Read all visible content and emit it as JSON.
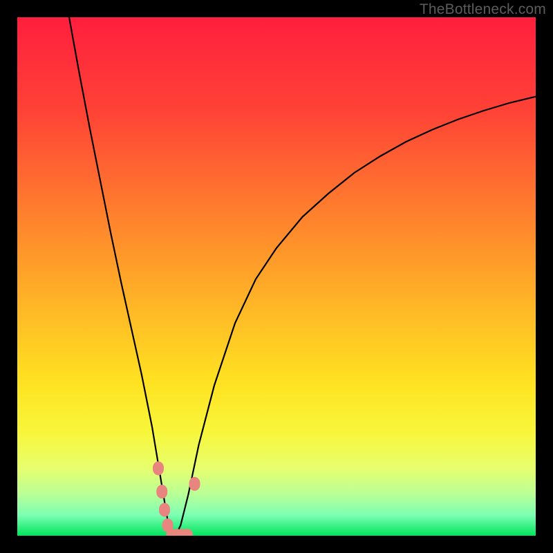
{
  "watermark": "TheBottleneck.com",
  "chart_data": {
    "type": "line",
    "title": "",
    "xlabel": "",
    "ylabel": "",
    "xlim": [
      0,
      100
    ],
    "ylim": [
      0,
      100
    ],
    "grid": false,
    "legend": false,
    "background_gradient_stops": [
      {
        "pos": 0.0,
        "color": "#ff1f3e"
      },
      {
        "pos": 0.18,
        "color": "#ff4236"
      },
      {
        "pos": 0.36,
        "color": "#ff7a2e"
      },
      {
        "pos": 0.54,
        "color": "#ffb127"
      },
      {
        "pos": 0.7,
        "color": "#ffe121"
      },
      {
        "pos": 0.8,
        "color": "#f8f63a"
      },
      {
        "pos": 0.87,
        "color": "#e7ff6e"
      },
      {
        "pos": 0.92,
        "color": "#b9ff97"
      },
      {
        "pos": 0.96,
        "color": "#7dffb3"
      },
      {
        "pos": 1.0,
        "color": "#00e45c"
      }
    ],
    "series": [
      {
        "name": "bottleneck-curve",
        "color": "#000000",
        "x": [
          10.0,
          12.0,
          14.0,
          16.0,
          18.0,
          20.0,
          22.0,
          24.0,
          26.0,
          27.0,
          28.0,
          29.0,
          29.8,
          30.5,
          31.5,
          33.0,
          35.0,
          38.0,
          42.0,
          46.0,
          50.0,
          55.0,
          60.0,
          65.0,
          70.0,
          75.0,
          80.0,
          85.0,
          90.0,
          95.0,
          100.0
        ],
        "y": [
          100.0,
          89.0,
          78.5,
          68.5,
          58.5,
          49.0,
          40.0,
          31.0,
          21.0,
          15.0,
          9.0,
          3.0,
          0.0,
          0.0,
          2.0,
          8.0,
          17.5,
          29.0,
          41.0,
          49.5,
          55.5,
          61.5,
          66.0,
          70.0,
          73.2,
          76.0,
          78.3,
          80.3,
          82.0,
          83.5,
          84.7
        ]
      }
    ],
    "markers": [
      {
        "name": "marker-cluster",
        "color": "#e9857f",
        "shape": "rounded",
        "points": [
          {
            "x": 27.2,
            "y": 13.0
          },
          {
            "x": 27.9,
            "y": 8.5
          },
          {
            "x": 28.4,
            "y": 5.0
          },
          {
            "x": 29.0,
            "y": 2.0
          },
          {
            "x": 29.8,
            "y": 0.0
          },
          {
            "x": 30.8,
            "y": 0.0
          },
          {
            "x": 31.8,
            "y": 0.0
          },
          {
            "x": 32.8,
            "y": 0.0
          },
          {
            "x": 34.2,
            "y": 10.0
          }
        ]
      }
    ]
  }
}
